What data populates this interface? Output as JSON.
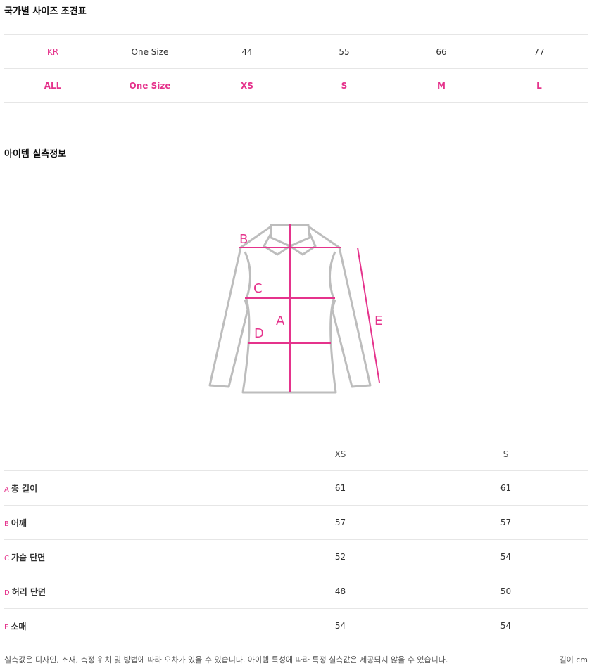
{
  "sections": {
    "size_chart_title": "국가별 사이즈 조견표",
    "measure_title": "아이템 실측정보"
  },
  "size_chart": {
    "rows": [
      {
        "label": "KR",
        "values": [
          "One Size",
          "44",
          "55",
          "66",
          "77"
        ]
      },
      {
        "label": "ALL",
        "values": [
          "One Size",
          "XS",
          "S",
          "M",
          "L"
        ]
      }
    ]
  },
  "diagram": {
    "labels": [
      "A",
      "B",
      "C",
      "D",
      "E"
    ],
    "accent_color": "#e5338c",
    "garment_color": "#bdbdbd"
  },
  "measurements": {
    "columns": [
      "XS",
      "S"
    ],
    "rows": [
      {
        "letter": "A",
        "name": "총 길이",
        "values": [
          "61",
          "61"
        ]
      },
      {
        "letter": "B",
        "name": "어깨",
        "values": [
          "57",
          "57"
        ]
      },
      {
        "letter": "C",
        "name": "가슴 단면",
        "values": [
          "52",
          "54"
        ]
      },
      {
        "letter": "D",
        "name": "허리 단면",
        "values": [
          "48",
          "50"
        ]
      },
      {
        "letter": "E",
        "name": "소매",
        "values": [
          "54",
          "54"
        ]
      }
    ]
  },
  "footer": {
    "note": "실측값은 디자인, 소재, 측정 위치 및 방법에 따라 오차가 있을 수 있습니다. 아이템 특성에 따라 특정 실측값은 제공되지 않을 수 있습니다.",
    "unit": "길이 cm"
  }
}
